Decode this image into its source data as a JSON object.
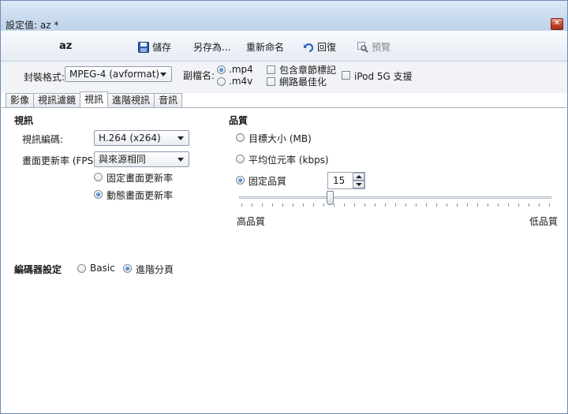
{
  "window": {
    "title": "設定值: az *",
    "close_glyph": "✕"
  },
  "toolbar": {
    "preset_name": "az",
    "save_label": "儲存",
    "save_as_label": "另存為...",
    "rename_label": "重新命名",
    "revert_label": "回復",
    "preview_label": "預覽"
  },
  "format": {
    "container_label": "封裝格式:",
    "container_value": "MPEG-4 (avformat)",
    "extension_label": "副檔名:",
    "ext_mp4": ".mp4",
    "ext_m4v": ".m4v",
    "ext_selected": ".mp4",
    "chapters_label": "包含章節標記",
    "web_optimized_label": "網路最佳化",
    "ipod_label": "iPod 5G 支援"
  },
  "tabs": [
    {
      "label": "影像"
    },
    {
      "label": "視訊濾鏡"
    },
    {
      "label": "視訊",
      "active": true
    },
    {
      "label": "進階視訊"
    },
    {
      "label": "音訊"
    }
  ],
  "video": {
    "section_title": "視訊",
    "codec_label": "視訊編碼:",
    "codec_value": "H.264 (x264)",
    "fps_label": "畫面更新率 (FPS):",
    "fps_value": "與來源相同",
    "cfr_label": "固定畫面更新率",
    "vfr_label": "動態畫面更新率",
    "framerate_mode_selected": "動態畫面更新率"
  },
  "quality": {
    "section_title": "品質",
    "target_size_label": "目標大小 (MB)",
    "avg_bitrate_label": "平均位元率 (kbps)",
    "constant_quality_label": "固定品質",
    "selected": "固定品質",
    "rf_value": "15",
    "slider_fraction": 0.29,
    "high_label": "高品質",
    "low_label": "低品質"
  },
  "encoder": {
    "section_title": "編碼器設定",
    "basic_label": "Basic",
    "advanced_label": "進階分頁",
    "selected": "進階分頁"
  },
  "colors": {
    "accent": "#1e5db5",
    "titlebar": "#c8daee",
    "close": "#c7412a"
  }
}
